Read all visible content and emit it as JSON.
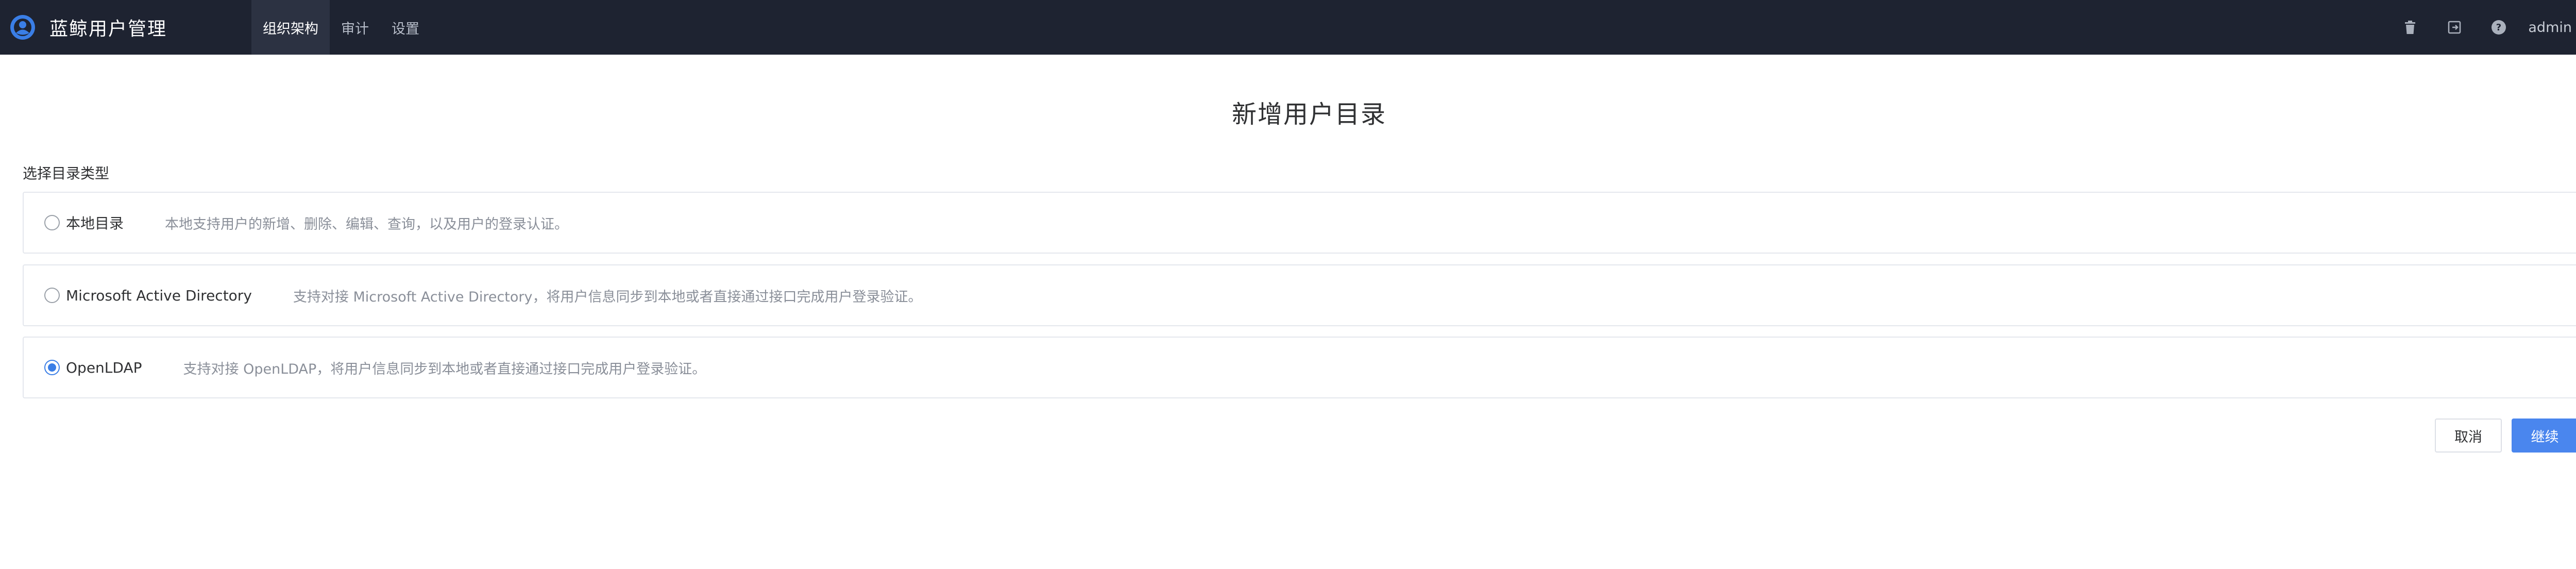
{
  "app": {
    "title": "蓝鲸用户管理",
    "logo_icon": "user-circle-logo"
  },
  "nav": {
    "items": [
      {
        "label": "组织架构",
        "active": true
      },
      {
        "label": "审计",
        "active": false
      },
      {
        "label": "设置",
        "active": false
      }
    ]
  },
  "topbar": {
    "icons": [
      "trash-icon",
      "logout-icon",
      "help-icon"
    ],
    "username": "admin"
  },
  "page": {
    "title": "新增用户目录",
    "section_label": "选择目录类型"
  },
  "options": [
    {
      "title": "本地目录",
      "description": "本地支持用户的新增、删除、编辑、查询，以及用户的登录认证。",
      "selected": false
    },
    {
      "title": "Microsoft Active Directory",
      "description": "支持对接 Microsoft Active Directory，将用户信息同步到本地或者直接通过接口完成用户登录验证。",
      "selected": false
    },
    {
      "title": "OpenLDAP",
      "description": "支持对接 OpenLDAP，将用户信息同步到本地或者直接通过接口完成用户登录验证。",
      "selected": true
    }
  ],
  "actions": {
    "cancel_label": "取消",
    "continue_label": "继续"
  },
  "colors": {
    "topbar_bg": "#1e2331",
    "accent": "#4a86ee",
    "radio_checked": "#3a7ee6"
  }
}
